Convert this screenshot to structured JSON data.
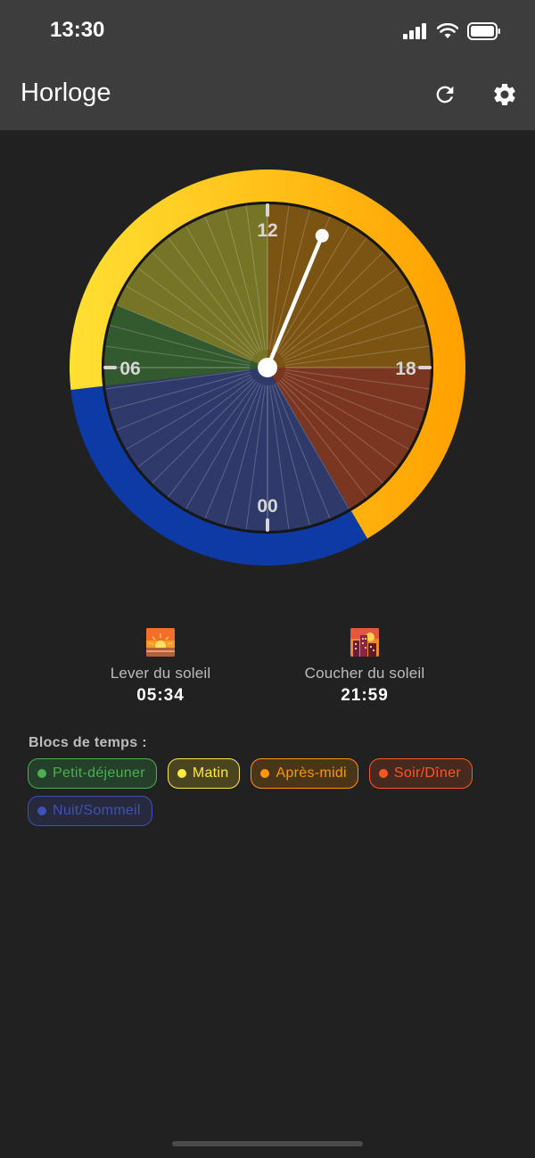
{
  "status": {
    "time": "13:30"
  },
  "appbar": {
    "title": "Horloge",
    "refresh_icon": "refresh-icon",
    "settings_icon": "gear-icon"
  },
  "clock": {
    "labels": {
      "top": "12",
      "left": "06",
      "right": "18",
      "bottom": "00"
    },
    "current_time": "13:30",
    "ring": {
      "day_start_hour": 5.57,
      "day_end_hour": 21.98,
      "day_color_start": "#ffe033",
      "day_color_end": "#ffa000",
      "night_color": "#0d3aa5"
    },
    "sectors": [
      {
        "name": "Nuit/Sommeil",
        "from": 21.98,
        "to": 5.57,
        "color": "#2f3a6a"
      },
      {
        "name": "Petit-déjeuner",
        "from": 5.57,
        "to": 7.5,
        "color": "#33592f"
      },
      {
        "name": "Matin",
        "from": 7.5,
        "to": 12,
        "color": "#767427"
      },
      {
        "name": "Après-midi",
        "from": 12,
        "to": 18,
        "color": "#7b5312"
      },
      {
        "name": "Soir/Dîner",
        "from": 18,
        "to": 21.98,
        "color": "#7a3620"
      }
    ]
  },
  "sun": {
    "sunrise": {
      "label": "Lever du soleil",
      "time": "05:34",
      "icon": "sunrise-icon"
    },
    "sunset": {
      "label": "Coucher du soleil",
      "time": "21:59",
      "icon": "city-sunset-icon"
    }
  },
  "blocks": {
    "title": "Blocs de temps :",
    "items": [
      {
        "label": "Petit-déjeuner",
        "color": "#4caf50",
        "bg": "#24402a"
      },
      {
        "label": "Matin",
        "color": "#ffeb3b",
        "bg": "#4a4520"
      },
      {
        "label": "Après-midi",
        "color": "#ff9800",
        "bg": "#4a3518"
      },
      {
        "label": "Soir/Dîner",
        "color": "#ff5722",
        "bg": "#472a1f"
      },
      {
        "label": "Nuit/Sommeil",
        "color": "#3f51b5",
        "bg": "#27293e"
      }
    ]
  }
}
